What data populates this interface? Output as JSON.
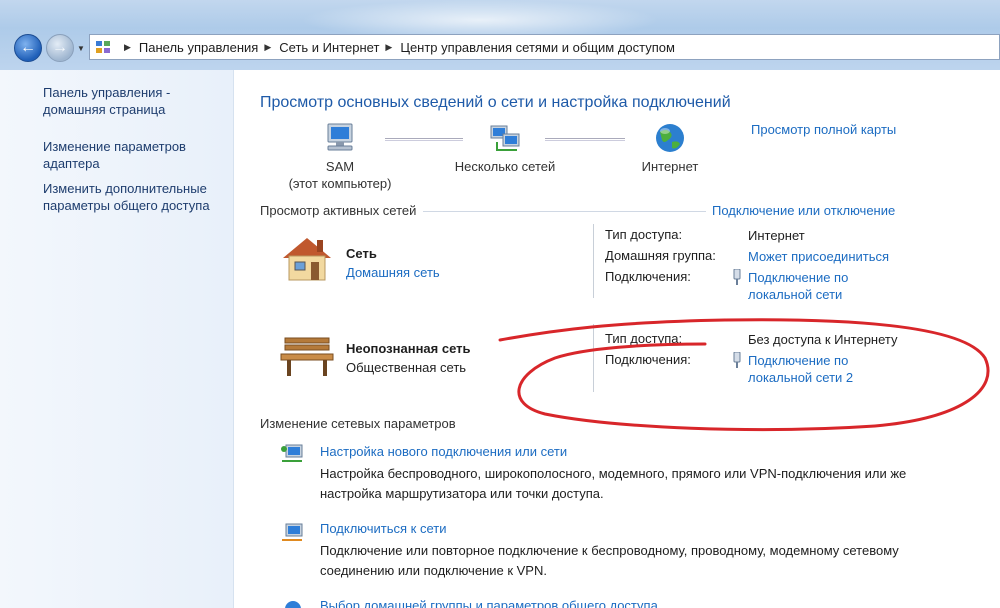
{
  "breadcrumb": {
    "items": [
      "Панель управления",
      "Сеть и Интернет",
      "Центр управления сетями и общим доступом"
    ]
  },
  "sidebar": {
    "links": [
      "Панель управления - домашняя страница",
      "Изменение параметров адаптера",
      "Изменить дополнительные параметры общего доступа"
    ]
  },
  "main": {
    "title": "Просмотр основных сведений о сети и настройка подключений",
    "full_map_link": "Просмотр полной карты",
    "map": {
      "computer_name": "SAM",
      "computer_sub": "(этот компьютер)",
      "network": "Несколько сетей",
      "internet": "Интернет"
    },
    "active_networks_label": "Просмотр активных сетей",
    "connect_disconnect_link": "Подключение или отключение",
    "networks": [
      {
        "name": "Сеть",
        "type": "Домашняя сеть",
        "access_label": "Тип доступа:",
        "access_value": "Интернет",
        "homegroup_label": "Домашняя группа:",
        "homegroup_value": "Может присоединиться",
        "connections_label": "Подключения:",
        "connection_value": "Подключение по локальной сети"
      },
      {
        "name": "Неопознанная сеть",
        "type": "Общественная сеть",
        "access_label": "Тип доступа:",
        "access_value": "Без доступа к Интернету",
        "connections_label": "Подключения:",
        "connection_value": "Подключение по локальной сети 2"
      }
    ],
    "change_settings_label": "Изменение сетевых параметров",
    "tasks": [
      {
        "title": "Настройка нового подключения или сети",
        "description": "Настройка беспроводного, широкополосного, модемного, прямого или VPN-подключения или же настройка маршрутизатора или точки доступа."
      },
      {
        "title": "Подключиться к сети",
        "description": "Подключение или повторное подключение к беспроводному, проводному, модемному сетевому соединению или подключение к VPN."
      },
      {
        "title": "Выбор домашней группы и параметров общего доступа"
      }
    ]
  },
  "colors": {
    "link": "#1c6cc2",
    "title": "#1e5aa8",
    "annotation": "#d8262a"
  },
  "icons": [
    "back-arrow-icon",
    "forward-arrow-icon",
    "control-panel-icon",
    "computer-icon",
    "network-icon",
    "globe-icon",
    "house-icon",
    "bench-icon",
    "plug-icon",
    "new-connection-icon",
    "connect-network-icon",
    "homegroup-icon"
  ]
}
